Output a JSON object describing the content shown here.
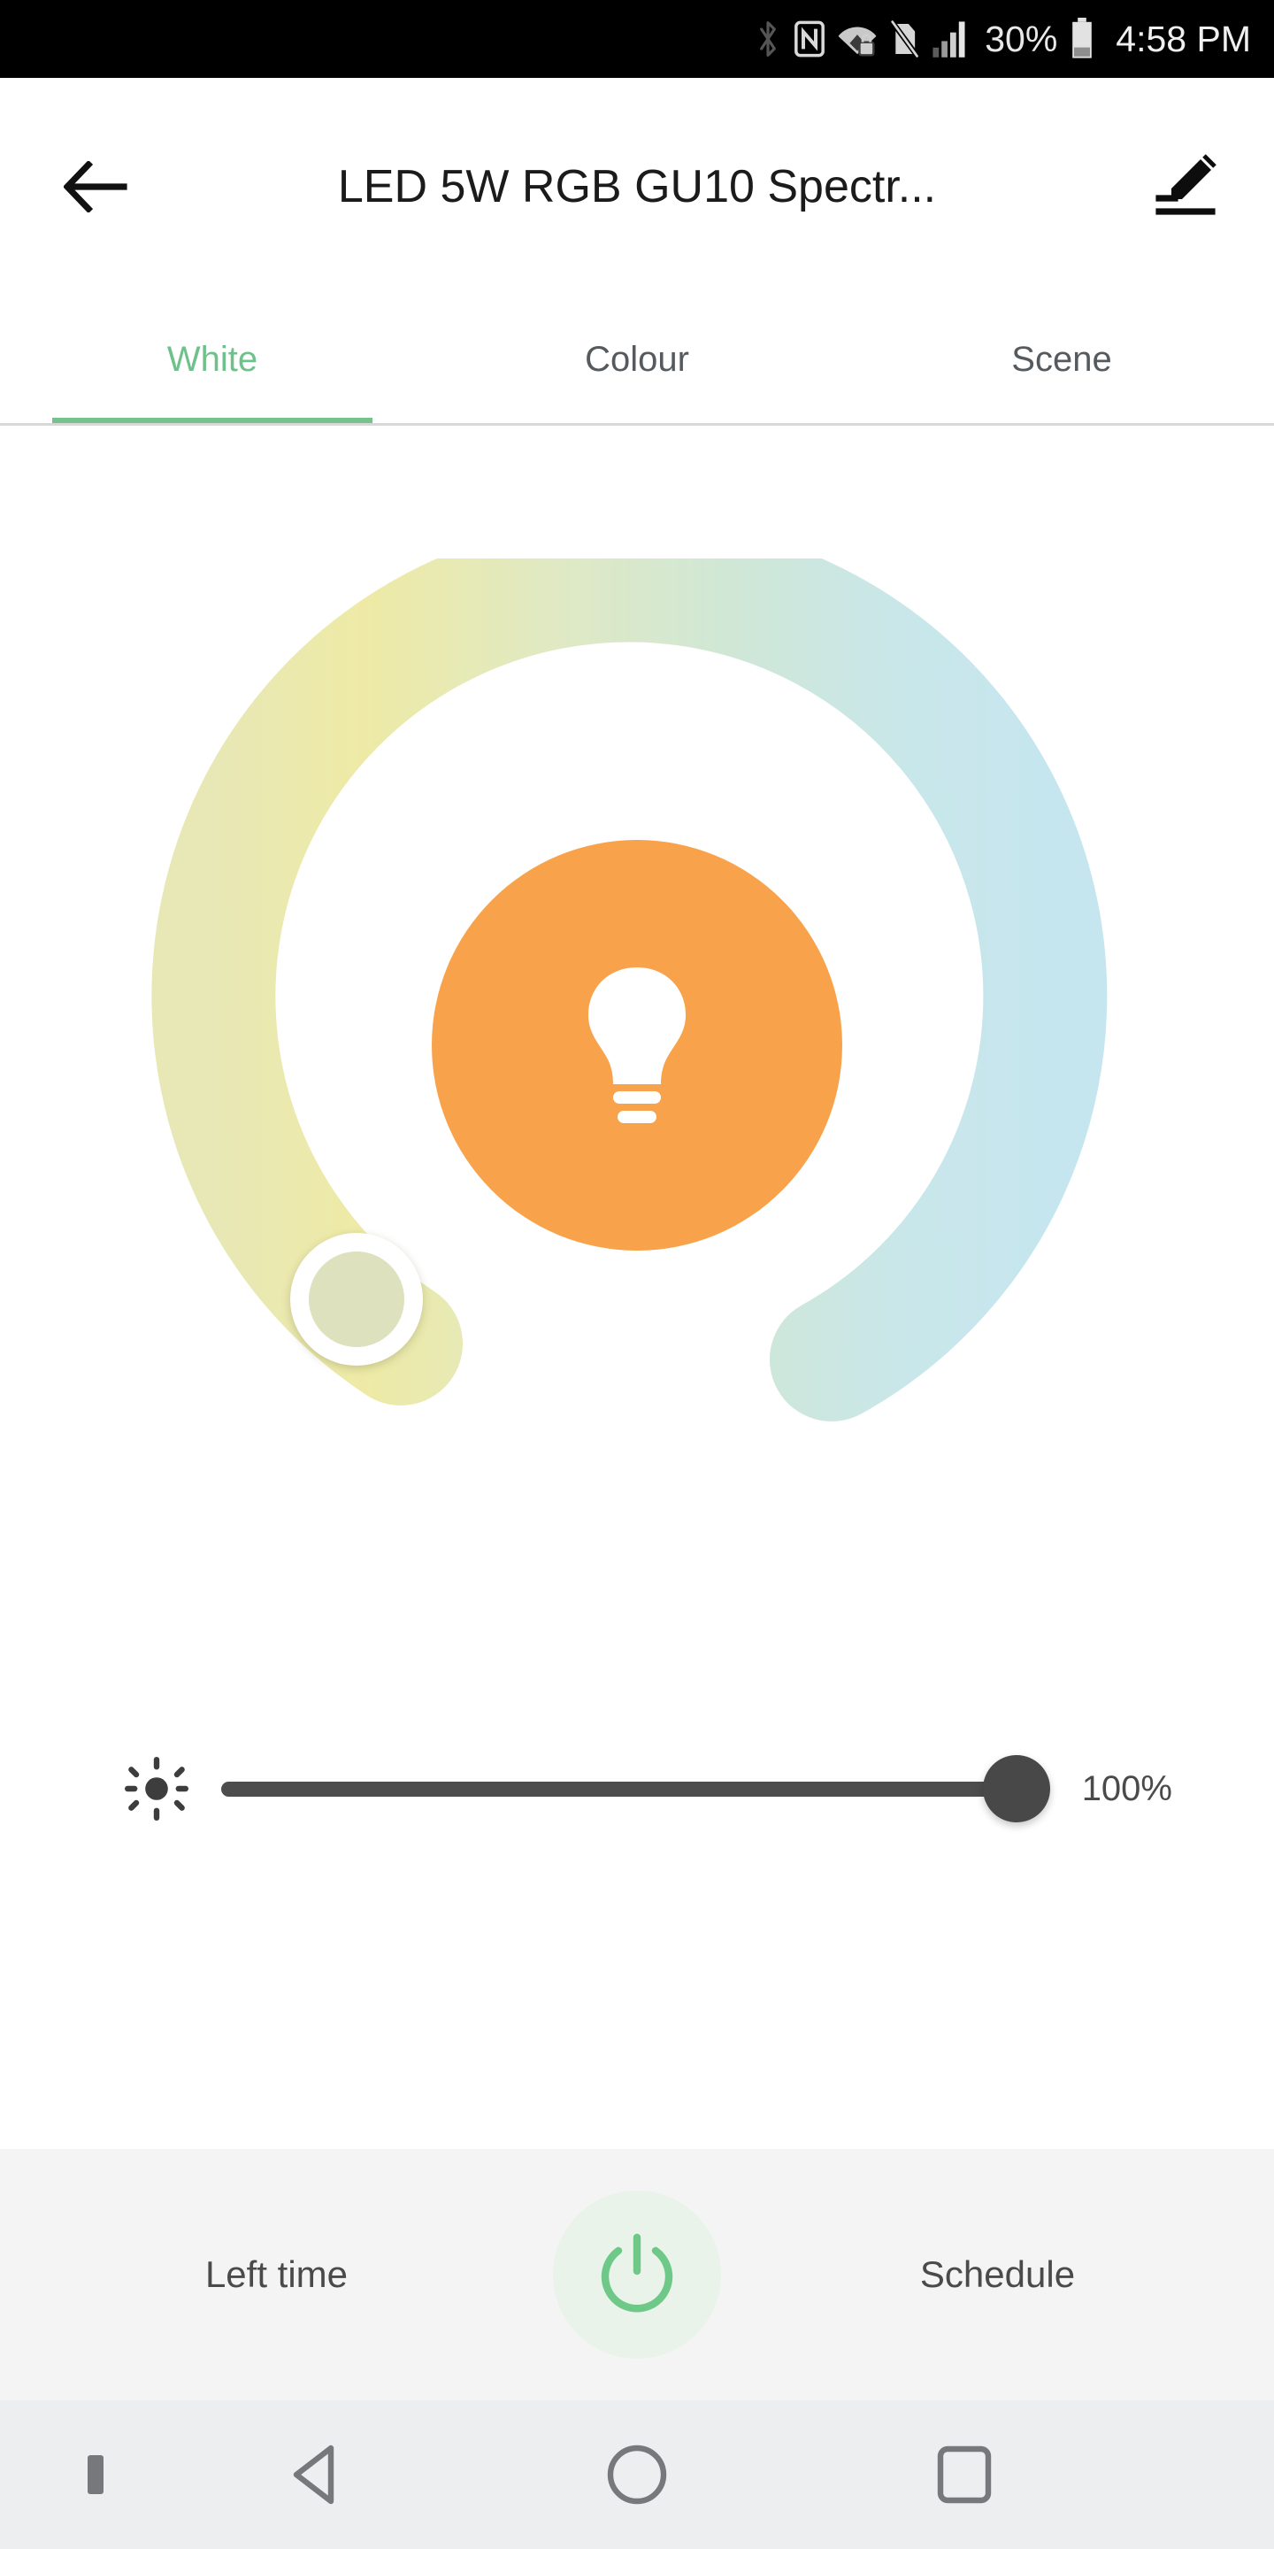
{
  "status_bar": {
    "icons": [
      "bluetooth-icon",
      "nfc-icon",
      "wifi-secured-icon",
      "sim-off-icon",
      "signal-bars-icon"
    ],
    "battery_percent": "30%",
    "time": "4:58 PM"
  },
  "app_bar": {
    "back_icon": "back-arrow-icon",
    "title": "LED 5W RGB GU10 Spectr...",
    "edit_icon": "edit-pencil-icon"
  },
  "tabs": [
    {
      "label": "White",
      "active": true
    },
    {
      "label": "Colour",
      "active": false
    },
    {
      "label": "Scene",
      "active": false
    }
  ],
  "colors": {
    "accent_green": "#77c18f",
    "bulb_orange": "#f8a34c",
    "ring_warm": "#f0e9a8",
    "ring_mid": "#d9e7cf",
    "ring_cool": "#c8e6ed",
    "thumb_fill": "#dde1bd",
    "slider_track": "#4d4d4d",
    "bottom_bar_bg": "#f4f4f4",
    "nav_bar_bg": "#eceef0"
  },
  "color_temperature": {
    "icon": "light-bulb-icon",
    "thumb_position_label": "warm",
    "track_name": "color-temperature-arc"
  },
  "brightness": {
    "icon": "brightness-sun-icon",
    "value_label": "100%",
    "value": 100,
    "min": 0,
    "max": 100
  },
  "bottom_actions": {
    "left_label": "Left time",
    "right_label": "Schedule",
    "power_icon": "power-icon"
  },
  "nav_bar": {
    "dot_icon": "nav-dot-icon",
    "back_icon": "nav-back-triangle-icon",
    "home_icon": "nav-home-circle-icon",
    "recents_icon": "nav-recents-square-icon"
  }
}
